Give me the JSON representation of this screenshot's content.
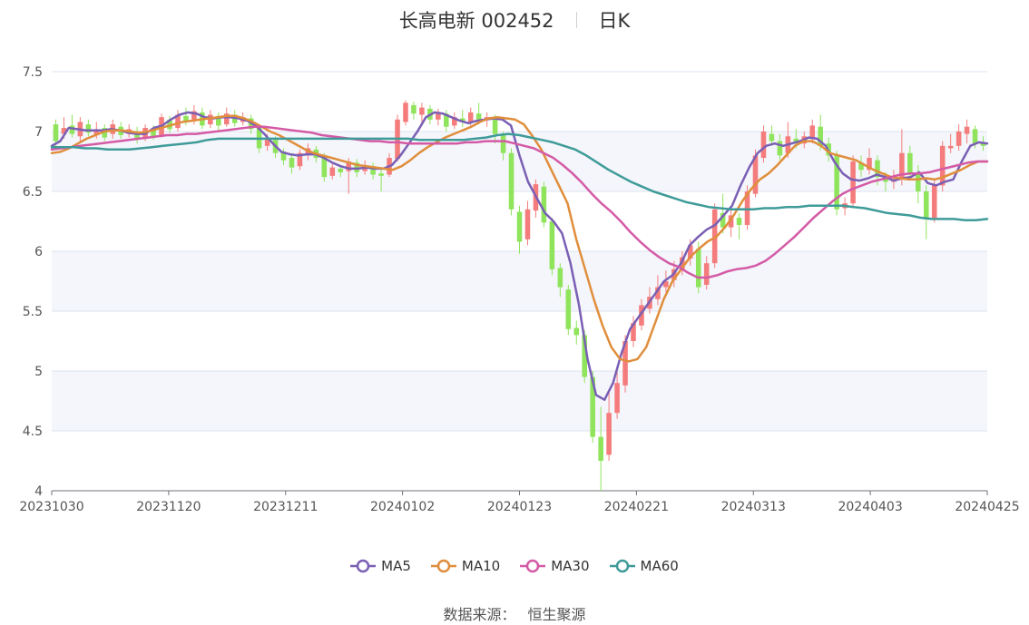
{
  "header": {
    "title": "长高电新 002452",
    "period": "日K"
  },
  "source": {
    "label": "数据来源：",
    "name": "恒生聚源"
  },
  "colors": {
    "up": "#f47c7c",
    "down": "#8fe45c",
    "ma5": "#7a5fb4",
    "ma10": "#e08e3c",
    "ma30": "#d45aa6",
    "ma60": "#3f9b99",
    "band": "#f4f6fb",
    "grid": "#dde3ef"
  },
  "chart_data": {
    "type": "candlestick",
    "ylim": [
      4,
      7.5
    ],
    "yticks": [
      "7.5",
      "7",
      "6.5",
      "6",
      "5.5",
      "5",
      "4.5",
      "4"
    ],
    "xticks": [
      "20231030",
      "20231120",
      "20231211",
      "20240102",
      "20240123",
      "20240221",
      "20240313",
      "20240403",
      "20240425"
    ],
    "ma_series": [
      {
        "name": "MA5",
        "values": [
          6.88,
          6.92,
          7.03,
          7.02,
          7.01,
          7.01,
          7.01,
          7.02,
          7.01,
          6.99,
          6.98,
          6.98,
          7.03,
          7.05,
          7.1,
          7.14,
          7.16,
          7.15,
          7.12,
          7.11,
          7.12,
          7.12,
          7.11,
          7.09,
          7.05,
          6.98,
          6.9,
          6.83,
          6.81,
          6.8,
          6.81,
          6.81,
          6.78,
          6.74,
          6.71,
          6.69,
          6.69,
          6.7,
          6.69,
          6.69,
          6.72,
          6.8,
          6.9,
          7.0,
          7.12,
          7.16,
          7.15,
          7.12,
          7.09,
          7.07,
          7.09,
          7.1,
          7.11,
          7.1,
          7.05,
          6.8,
          6.58,
          6.45,
          6.32,
          6.25,
          6.15,
          5.9,
          5.55,
          5.1,
          4.8,
          4.76,
          4.9,
          5.15,
          5.35,
          5.45,
          5.55,
          5.65,
          5.75,
          5.8,
          5.9,
          6.05,
          6.12,
          6.18,
          6.22,
          6.3,
          6.38,
          6.55,
          6.7,
          6.82,
          6.88,
          6.9,
          6.88,
          6.9,
          6.92,
          6.95,
          6.94,
          6.88,
          6.75,
          6.65,
          6.6,
          6.59,
          6.61,
          6.64,
          6.62,
          6.59,
          6.61,
          6.62,
          6.66,
          6.57,
          6.55,
          6.58,
          6.6,
          6.75,
          6.88,
          6.91,
          6.9
        ]
      },
      {
        "name": "MA10",
        "values": [
          6.82,
          6.83,
          6.86,
          6.9,
          6.94,
          6.97,
          7.0,
          7.01,
          7.01,
          7.0,
          6.99,
          7.0,
          7.02,
          7.04,
          7.06,
          7.08,
          7.09,
          7.1,
          7.11,
          7.12,
          7.13,
          7.13,
          7.11,
          7.08,
          7.04,
          7.0,
          6.97,
          6.93,
          6.89,
          6.85,
          6.82,
          6.8,
          6.78,
          6.76,
          6.74,
          6.72,
          6.71,
          6.7,
          6.69,
          6.68,
          6.71,
          6.76,
          6.82,
          6.87,
          6.91,
          6.95,
          6.98,
          7.01,
          7.04,
          7.08,
          7.11,
          7.12,
          7.11,
          7.1,
          7.06,
          6.96,
          6.85,
          6.7,
          6.55,
          6.4,
          6.1,
          5.85,
          5.6,
          5.38,
          5.2,
          5.1,
          5.08,
          5.1,
          5.2,
          5.4,
          5.6,
          5.75,
          5.85,
          5.95,
          6.02,
          6.08,
          6.12,
          6.2,
          6.3,
          6.42,
          6.52,
          6.6,
          6.65,
          6.72,
          6.8,
          6.88,
          6.92,
          6.92,
          6.88,
          6.82,
          6.8,
          6.78,
          6.76,
          6.72,
          6.68,
          6.65,
          6.62,
          6.61,
          6.6,
          6.6,
          6.61,
          6.6,
          6.62,
          6.65,
          6.68,
          6.72,
          6.75,
          6.75
        ]
      },
      {
        "name": "MA30",
        "values": [
          6.85,
          6.86,
          6.87,
          6.88,
          6.89,
          6.9,
          6.91,
          6.92,
          6.93,
          6.94,
          6.95,
          6.96,
          6.97,
          6.97,
          6.98,
          6.98,
          6.99,
          7.0,
          7.01,
          7.02,
          7.03,
          7.04,
          7.04,
          7.03,
          7.02,
          7.01,
          7.0,
          6.99,
          6.97,
          6.96,
          6.95,
          6.94,
          6.93,
          6.92,
          6.92,
          6.91,
          6.91,
          6.9,
          6.9,
          6.9,
          6.9,
          6.9,
          6.9,
          6.91,
          6.91,
          6.92,
          6.92,
          6.92,
          6.9,
          6.88,
          6.86,
          6.82,
          6.78,
          6.72,
          6.65,
          6.57,
          6.48,
          6.4,
          6.33,
          6.25,
          6.16,
          6.08,
          6.01,
          5.95,
          5.9,
          5.87,
          5.82,
          5.78,
          5.78,
          5.8,
          5.83,
          5.85,
          5.86,
          5.88,
          5.92,
          5.98,
          6.05,
          6.12,
          6.2,
          6.28,
          6.35,
          6.42,
          6.48,
          6.52,
          6.55,
          6.58,
          6.6,
          6.62,
          6.64,
          6.65,
          6.65,
          6.66,
          6.68,
          6.7,
          6.72,
          6.74,
          6.75,
          6.75
        ]
      },
      {
        "name": "MA60",
        "values": [
          6.87,
          6.87,
          6.87,
          6.86,
          6.86,
          6.85,
          6.85,
          6.85,
          6.86,
          6.87,
          6.88,
          6.89,
          6.9,
          6.91,
          6.93,
          6.94,
          6.94,
          6.94,
          6.94,
          6.94,
          6.94,
          6.94,
          6.94,
          6.94,
          6.94,
          6.94,
          6.94,
          6.94,
          6.94,
          6.94,
          6.94,
          6.94,
          6.94,
          6.93,
          6.93,
          6.93,
          6.93,
          6.93,
          6.94,
          6.95,
          6.97,
          6.98,
          6.97,
          6.95,
          6.93,
          6.91,
          6.88,
          6.85,
          6.8,
          6.74,
          6.68,
          6.63,
          6.58,
          6.54,
          6.5,
          6.47,
          6.44,
          6.41,
          6.39,
          6.37,
          6.36,
          6.35,
          6.35,
          6.35,
          6.36,
          6.36,
          6.37,
          6.37,
          6.38,
          6.38,
          6.38,
          6.38,
          6.37,
          6.36,
          6.34,
          6.32,
          6.31,
          6.3,
          6.28,
          6.27,
          6.27,
          6.27,
          6.26,
          6.26,
          6.27
        ]
      }
    ],
    "candles": [
      [
        7.06,
        6.92,
        7.1,
        6.85
      ],
      [
        6.98,
        7.03,
        7.12,
        6.94
      ],
      [
        7.05,
        6.98,
        7.14,
        6.95
      ],
      [
        6.96,
        7.08,
        7.12,
        6.92
      ],
      [
        7.06,
        6.99,
        7.1,
        6.96
      ],
      [
        6.97,
        7.02,
        7.08,
        6.94
      ],
      [
        7.03,
        6.95,
        7.06,
        6.92
      ],
      [
        6.98,
        7.06,
        7.1,
        6.94
      ],
      [
        7.04,
        6.97,
        7.08,
        6.94
      ],
      [
        6.98,
        7.02,
        7.06,
        6.95
      ],
      [
        7.0,
        6.94,
        7.04,
        6.9
      ],
      [
        6.95,
        7.03,
        7.06,
        6.92
      ],
      [
        7.02,
        6.96,
        7.05,
        6.93
      ],
      [
        6.97,
        7.12,
        7.15,
        6.95
      ],
      [
        7.1,
        7.02,
        7.13,
        6.99
      ],
      [
        7.03,
        7.14,
        7.18,
        7.0
      ],
      [
        7.13,
        7.08,
        7.2,
        7.05
      ],
      [
        7.1,
        7.17,
        7.22,
        7.06
      ],
      [
        7.16,
        7.05,
        7.2,
        7.02
      ],
      [
        7.06,
        7.14,
        7.18,
        7.03
      ],
      [
        7.13,
        7.05,
        7.16,
        7.01
      ],
      [
        7.06,
        7.15,
        7.2,
        7.04
      ],
      [
        7.14,
        7.07,
        7.18,
        7.04
      ],
      [
        7.08,
        7.12,
        7.16,
        7.05
      ],
      [
        7.11,
        7.02,
        7.14,
        6.98
      ],
      [
        7.03,
        6.86,
        7.05,
        6.82
      ],
      [
        6.88,
        6.95,
        6.98,
        6.84
      ],
      [
        6.93,
        6.82,
        6.96,
        6.78
      ],
      [
        6.83,
        6.76,
        6.86,
        6.72
      ],
      [
        6.78,
        6.7,
        6.82,
        6.65
      ],
      [
        6.71,
        6.82,
        6.85,
        6.68
      ],
      [
        6.8,
        6.86,
        6.9,
        6.76
      ],
      [
        6.85,
        6.78,
        6.88,
        6.74
      ],
      [
        6.79,
        6.62,
        6.82,
        6.58
      ],
      [
        6.63,
        6.7,
        6.74,
        6.6
      ],
      [
        6.69,
        6.66,
        6.72,
        6.62
      ],
      [
        6.67,
        6.75,
        6.78,
        6.48
      ],
      [
        6.74,
        6.66,
        6.77,
        6.62
      ],
      [
        6.67,
        6.72,
        6.76,
        6.64
      ],
      [
        6.71,
        6.64,
        6.74,
        6.6
      ],
      [
        6.65,
        6.63,
        6.7,
        6.5
      ],
      [
        6.64,
        6.78,
        6.82,
        6.62
      ],
      [
        6.77,
        7.1,
        7.14,
        6.75
      ],
      [
        7.08,
        7.24,
        7.26,
        7.05
      ],
      [
        7.22,
        7.15,
        7.25,
        7.1
      ],
      [
        7.14,
        7.2,
        7.24,
        7.08
      ],
      [
        7.19,
        7.1,
        7.22,
        7.06
      ],
      [
        7.1,
        7.16,
        7.19,
        7.05
      ],
      [
        7.15,
        7.04,
        7.18,
        7.0
      ],
      [
        7.05,
        7.12,
        7.16,
        7.02
      ],
      [
        7.11,
        7.08,
        7.18,
        7.04
      ],
      [
        7.08,
        7.16,
        7.2,
        7.05
      ],
      [
        7.15,
        7.1,
        7.24,
        7.06
      ],
      [
        7.1,
        7.12,
        7.16,
        7.04
      ],
      [
        7.12,
        6.98,
        7.14,
        6.9
      ],
      [
        6.97,
        6.82,
        7.0,
        6.76
      ],
      [
        6.82,
        6.35,
        6.86,
        6.3
      ],
      [
        6.33,
        6.08,
        6.38,
        5.98
      ],
      [
        6.1,
        6.35,
        6.42,
        6.05
      ],
      [
        6.34,
        6.56,
        6.6,
        6.28
      ],
      [
        6.54,
        6.24,
        6.58,
        6.2
      ],
      [
        6.25,
        5.85,
        6.28,
        5.8
      ],
      [
        5.86,
        5.7,
        5.9,
        5.62
      ],
      [
        5.68,
        5.35,
        5.72,
        5.3
      ],
      [
        5.36,
        5.3,
        5.42,
        5.22
      ],
      [
        5.3,
        4.95,
        5.34,
        4.9
      ],
      [
        4.95,
        4.45,
        5.0,
        4.4
      ],
      [
        4.45,
        4.25,
        4.7,
        4.0
      ],
      [
        4.3,
        4.65,
        4.82,
        4.25
      ],
      [
        4.65,
        4.9,
        5.0,
        4.6
      ],
      [
        4.88,
        5.25,
        5.3,
        4.82
      ],
      [
        5.25,
        5.4,
        5.46,
        5.2
      ],
      [
        5.38,
        5.55,
        5.6,
        5.34
      ],
      [
        5.52,
        5.62,
        5.7,
        5.48
      ],
      [
        5.6,
        5.7,
        5.8,
        5.55
      ],
      [
        5.7,
        5.75,
        5.84,
        5.66
      ],
      [
        5.76,
        5.85,
        5.92,
        5.7
      ],
      [
        5.84,
        5.95,
        6.0,
        5.8
      ],
      [
        5.94,
        6.05,
        6.1,
        5.88
      ],
      [
        6.02,
        5.7,
        6.08,
        5.65
      ],
      [
        5.72,
        5.9,
        5.96,
        5.68
      ],
      [
        5.9,
        6.35,
        6.4,
        5.86
      ],
      [
        6.32,
        6.2,
        6.48,
        6.15
      ],
      [
        6.2,
        6.3,
        6.36,
        6.12
      ],
      [
        6.28,
        6.22,
        6.32,
        6.1
      ],
      [
        6.22,
        6.5,
        6.55,
        6.18
      ],
      [
        6.48,
        6.8,
        6.85,
        6.45
      ],
      [
        6.78,
        7.0,
        7.05,
        6.74
      ],
      [
        6.98,
        6.92,
        7.05,
        6.88
      ],
      [
        6.92,
        6.8,
        6.98,
        6.76
      ],
      [
        6.82,
        6.96,
        7.08,
        6.78
      ],
      [
        6.94,
        6.9,
        7.02,
        6.86
      ],
      [
        6.9,
        6.96,
        7.0,
        6.86
      ],
      [
        6.95,
        7.05,
        7.1,
        6.9
      ],
      [
        7.04,
        6.88,
        7.14,
        6.84
      ],
      [
        6.9,
        6.8,
        6.95,
        6.75
      ],
      [
        6.8,
        6.35,
        6.84,
        6.3
      ],
      [
        6.36,
        6.4,
        6.45,
        6.3
      ],
      [
        6.4,
        6.75,
        6.8,
        6.36
      ],
      [
        6.74,
        6.68,
        6.8,
        6.62
      ],
      [
        6.68,
        6.78,
        6.86,
        6.64
      ],
      [
        6.76,
        6.62,
        6.8,
        6.55
      ],
      [
        6.62,
        6.58,
        6.66,
        6.5
      ],
      [
        6.58,
        6.6,
        6.68,
        6.52
      ],
      [
        6.6,
        6.82,
        7.02,
        6.55
      ],
      [
        6.82,
        6.65,
        6.88,
        6.6
      ],
      [
        6.66,
        6.5,
        6.72,
        6.4
      ],
      [
        6.5,
        6.28,
        6.55,
        6.1
      ],
      [
        6.28,
        6.55,
        6.6,
        6.24
      ],
      [
        6.55,
        6.88,
        6.92,
        6.5
      ],
      [
        6.86,
        6.88,
        6.98,
        6.82
      ],
      [
        6.88,
        7.0,
        7.06,
        6.84
      ],
      [
        6.98,
        7.04,
        7.1,
        6.9
      ],
      [
        7.02,
        6.9,
        7.05,
        6.86
      ],
      [
        6.9,
        6.88,
        6.96,
        6.84
      ]
    ]
  },
  "legend": [
    {
      "label": "MA5",
      "color": "#7a5fb4"
    },
    {
      "label": "MA10",
      "color": "#e08e3c"
    },
    {
      "label": "MA30",
      "color": "#d45aa6"
    },
    {
      "label": "MA60",
      "color": "#3f9b99"
    }
  ]
}
